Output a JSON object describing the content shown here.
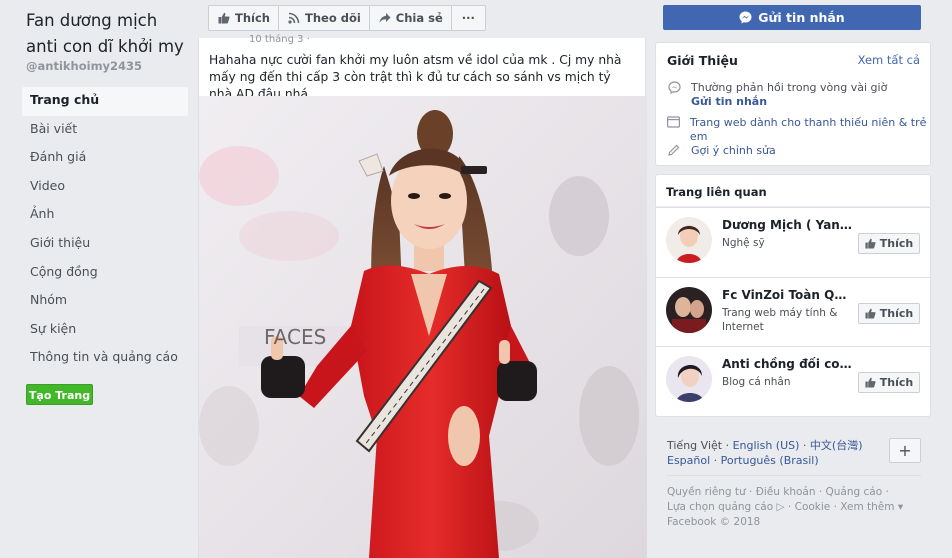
{
  "page": {
    "name": "Fan dương mịch anti con dĩ khởi my",
    "handle": "@antikhoimy2435"
  },
  "nav": {
    "items": [
      {
        "label": "Trang chủ"
      },
      {
        "label": "Bài viết"
      },
      {
        "label": "Đánh giá"
      },
      {
        "label": "Video"
      },
      {
        "label": "Ảnh"
      },
      {
        "label": "Giới thiệu"
      },
      {
        "label": "Cộng đồng"
      },
      {
        "label": "Nhóm"
      },
      {
        "label": "Sự kiện"
      },
      {
        "label": "Thông tin và quảng cáo"
      }
    ],
    "create_page": "Tạo Trang"
  },
  "actions": {
    "like": "Thích",
    "follow": "Theo dõi",
    "share": "Chia sẻ",
    "more": "···"
  },
  "post": {
    "date": "10 tháng 3 ·",
    "text": "Hahaha nực cười fan khởi my luôn atsm về idol của mk . Cj my nhà mấy ng đến thi cấp 3 còn trật thì k đủ tư cách so sánh vs mịch tỷ nhà AD đâu nhá"
  },
  "sidebar": {
    "send_message": "Gửi tin nhắn",
    "about": {
      "title": "Giới Thiệu",
      "see_all": "Xem tất cả",
      "response": "Thường phản hồi trong vòng vài giờ",
      "send_link": "Gửi tin nhắn",
      "category": "Trang web dành cho thanh thiếu niên & trẻ em",
      "suggest_edit": "Gợi ý chỉnh sửa"
    },
    "related": {
      "title": "Trang liên quan",
      "items": [
        {
          "name": "Dương Mịch ( YangMi )",
          "category": "Nghệ sỹ",
          "like": "Thích"
        },
        {
          "name": "Fc VinZoi Toàn Quốc",
          "category": "Trang web máy tính & Internet",
          "like": "Thích"
        },
        {
          "name": "Anti chồng đối con điên",
          "category": "Blog cá nhân",
          "like": "Thích"
        }
      ]
    },
    "languages": {
      "current": "Tiếng Việt",
      "others": [
        "English (US)",
        "中文(台灣)",
        "Español",
        "Português (Brasil)"
      ],
      "more": "+"
    },
    "footer": {
      "links": [
        "Quyền riêng tư",
        "Điều khoản",
        "Quảng cáo",
        "Lựa chọn quảng cáo",
        "Cookie",
        "Xem thêm"
      ],
      "copyright": "Facebook © 2018"
    }
  },
  "colors": {
    "brand": "#4267b2",
    "create_green": "#42b72a",
    "link": "#385898",
    "bg": "#e9ebee"
  }
}
